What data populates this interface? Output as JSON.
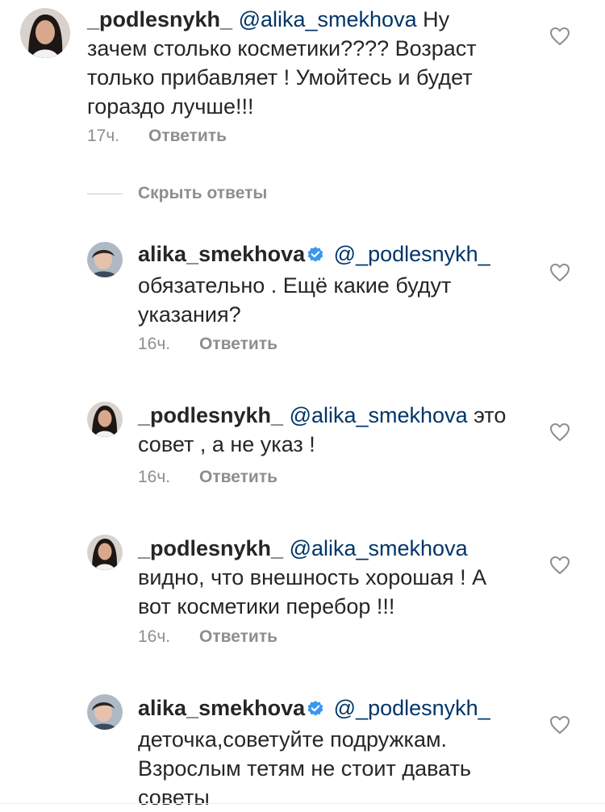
{
  "comments": [
    {
      "username": "_podlesnykh_",
      "mention": "@alika_smekhova",
      "text_after_mention": " Ну",
      "lines": [
        "зачем столько косметики???? Возраст",
        "только прибавляет ! Умойтесь и будет",
        "гораздо лучше!!!"
      ],
      "time": "17ч.",
      "reply_label": "Ответить",
      "verified": false
    },
    {
      "username": "alika_smekhova",
      "mention": "@_podlesnykh_",
      "text_after_mention": "",
      "lines": [
        "обязательно . Ещё какие будут",
        "указания?"
      ],
      "time": "16ч.",
      "reply_label": "Ответить",
      "verified": true
    },
    {
      "username": "_podlesnykh_",
      "mention": "@alika_smekhova",
      "text_after_mention": " это",
      "lines": [
        "совет , а не указ !"
      ],
      "time": "16ч.",
      "reply_label": "Ответить",
      "verified": false
    },
    {
      "username": "_podlesnykh_",
      "mention": "@alika_smekhova",
      "text_after_mention": "",
      "lines": [
        "видно, что внешность хорошая ! А",
        "вот косметики перебор !!!"
      ],
      "time": "16ч.",
      "reply_label": "Ответить",
      "verified": false
    },
    {
      "username": "alika_smekhova",
      "mention": "@_podlesnykh_",
      "text_after_mention": "",
      "lines": [
        "деточка,советуйте подружкам.",
        "Взрослым тетям не стоит давать",
        "советы"
      ],
      "verified": true
    }
  ],
  "replies_toggle": {
    "label": "Скрыть ответы"
  },
  "icons": {
    "like": "heart-outline-icon",
    "verified": "verified-badge-icon"
  },
  "colors": {
    "mention": "#003569",
    "meta": "#8e8e8e",
    "verified": "#3897f0"
  }
}
